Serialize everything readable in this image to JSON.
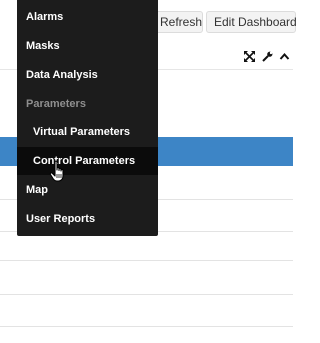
{
  "toolbar": {
    "refresh_label": "Refresh",
    "edit_dashboard_label": "Edit Dashboard"
  },
  "panel": {
    "icons": [
      "expand-icon",
      "wrench-icon",
      "chevron-up-icon"
    ]
  },
  "menu": {
    "items": [
      {
        "label": "Alarms",
        "type": "item"
      },
      {
        "label": "Masks",
        "type": "item"
      },
      {
        "label": "Data Analysis",
        "type": "item"
      },
      {
        "label": "Parameters",
        "type": "header"
      },
      {
        "label": "Virtual Parameters",
        "type": "sub"
      },
      {
        "label": "Control Parameters",
        "type": "sub",
        "hovered": true
      },
      {
        "label": "Map",
        "type": "item"
      },
      {
        "label": "User Reports",
        "type": "item"
      }
    ]
  },
  "colors": {
    "menu_background": "#1c1c1c",
    "menu_header_text": "#8e8e8e",
    "row_highlight": "#3d85c6"
  }
}
